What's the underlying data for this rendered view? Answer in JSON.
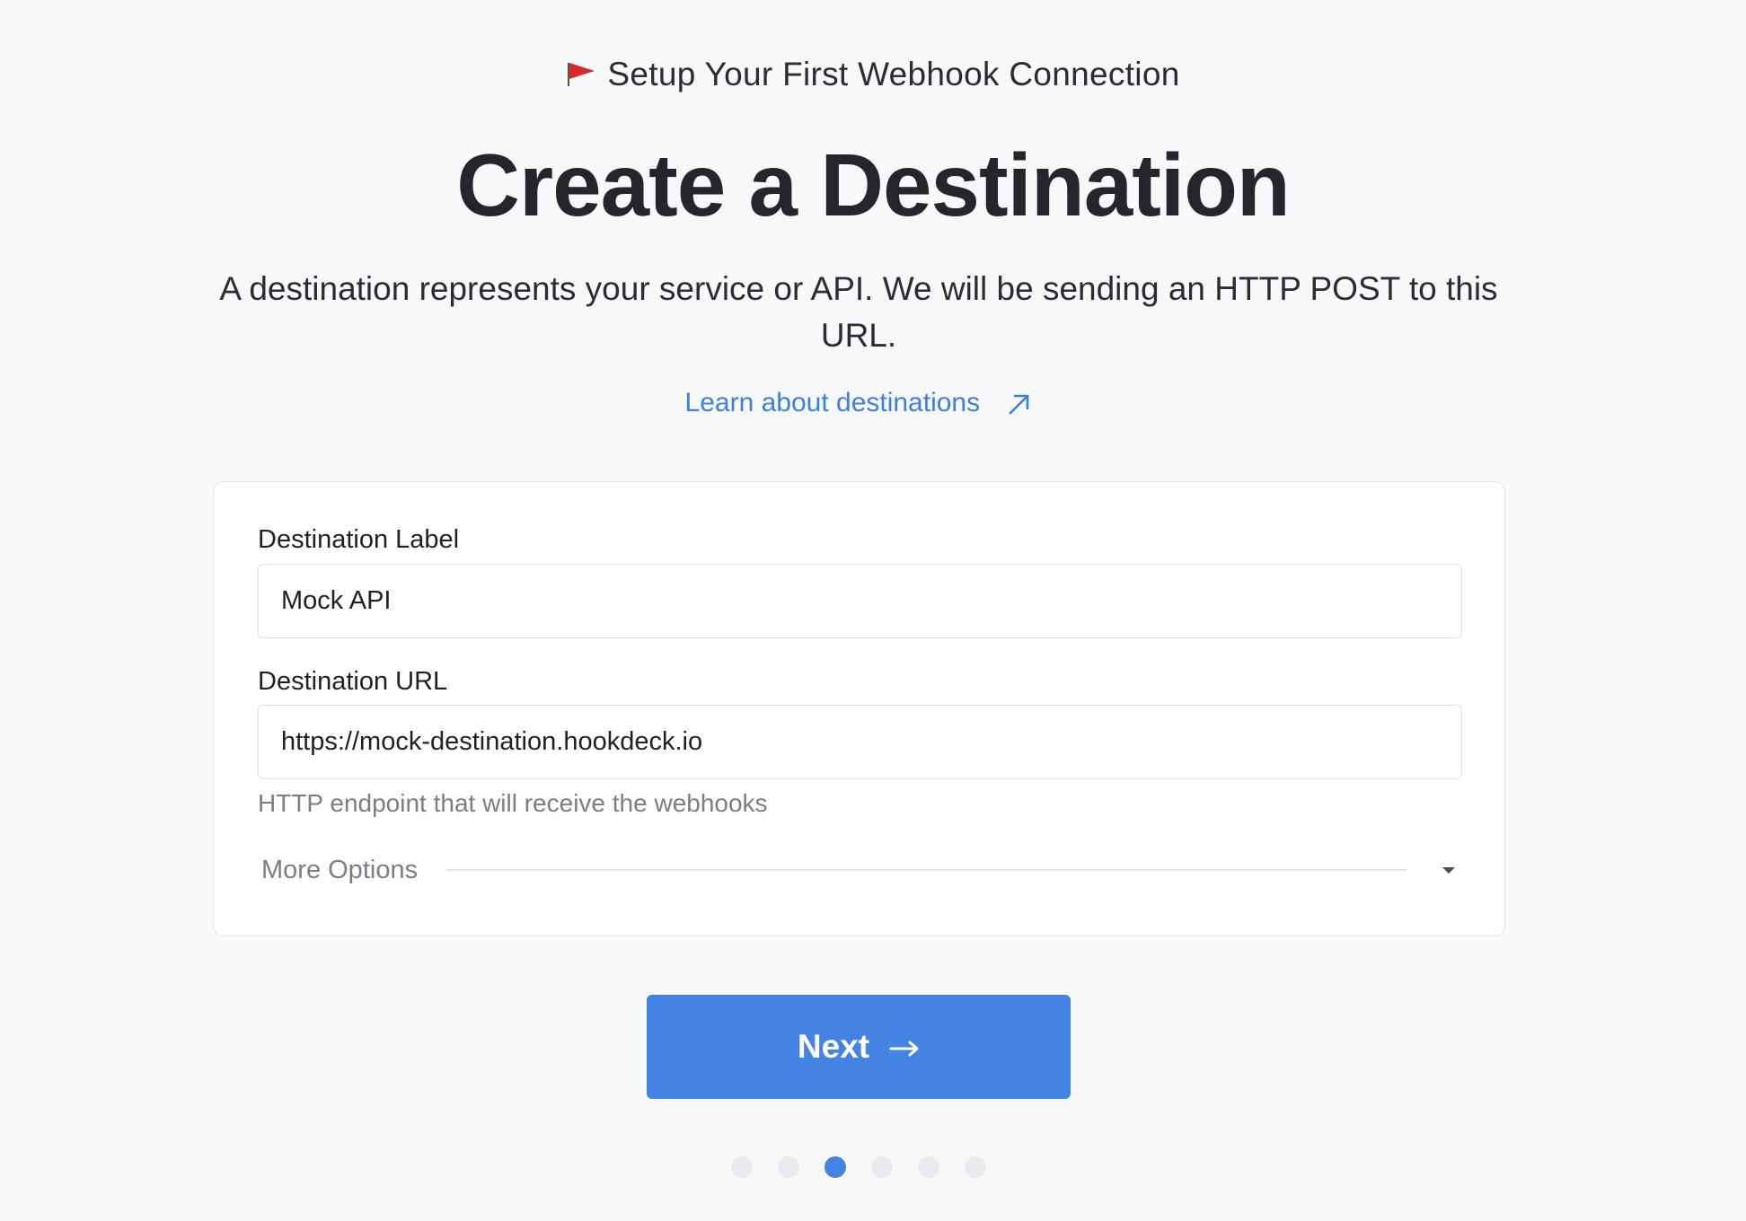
{
  "header": {
    "eyebrow_icon": "flag-icon",
    "eyebrow": "Setup Your First Webhook Connection",
    "title": "Create a Destination",
    "description": "A destination represents your service or API. We will be sending an HTTP POST to this URL.",
    "learn_link": "Learn about destinations",
    "learn_link_icon": "arrow-up-right-icon"
  },
  "form": {
    "label_field": {
      "label": "Destination Label",
      "value": "Mock API"
    },
    "url_field": {
      "label": "Destination URL",
      "value": "https://mock-destination.hookdeck.io",
      "helper": "HTTP endpoint that will receive the webhooks"
    },
    "more_options": {
      "label": "More Options",
      "icon": "caret-down-icon"
    }
  },
  "actions": {
    "next_label": "Next",
    "next_icon": "arrow-right-icon"
  },
  "progress": {
    "total_steps": 6,
    "current_step": 3
  },
  "colors": {
    "accent": "#4383e4",
    "link": "#3e7fdf",
    "background": "#f7f8fa",
    "flag": "#d42a2a"
  }
}
